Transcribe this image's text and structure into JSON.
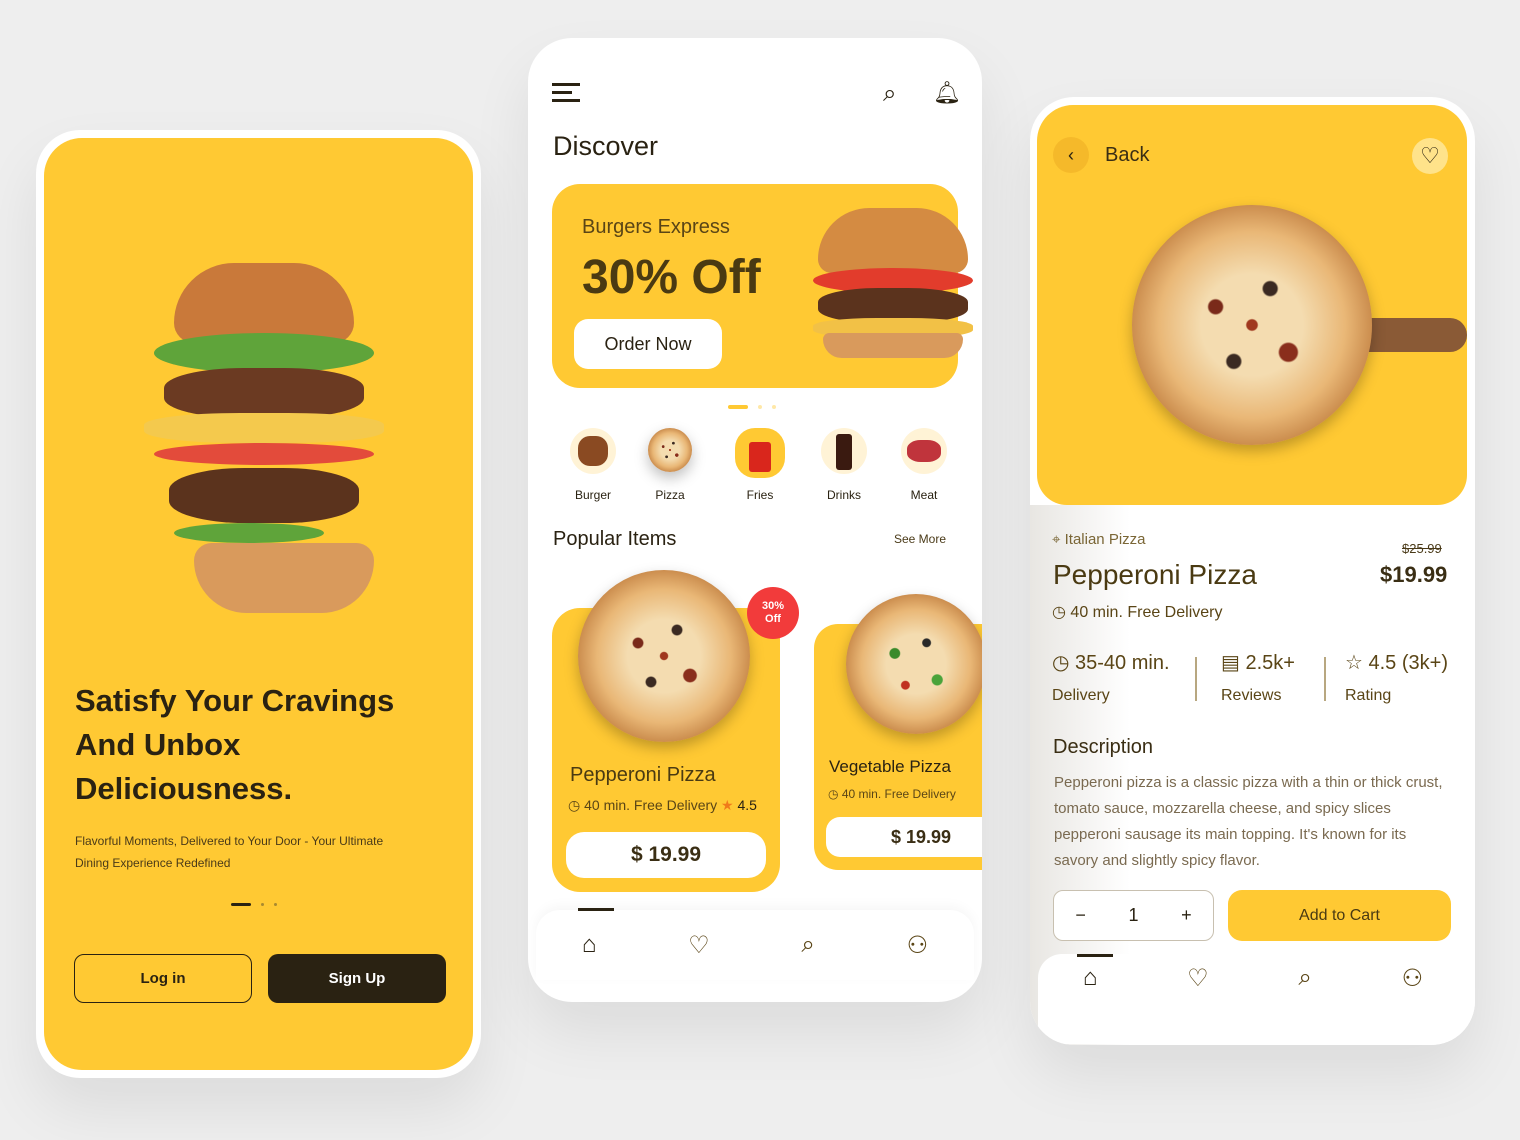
{
  "colors": {
    "accent": "#ffc933",
    "dark": "#2a2212",
    "brown": "#5a4516",
    "badge": "#f23b3b"
  },
  "onboarding": {
    "headline_lines": [
      "Satisfy Your Cravings",
      "And Unbox",
      "Deliciousness."
    ],
    "subtitle_lines": [
      "Flavorful Moments, Delivered to Your Door - Your Ultimate",
      "Dining Experience Redefined"
    ],
    "login_label": "Log in",
    "signup_label": "Sign Up"
  },
  "discover": {
    "title": "Discover",
    "icons": [
      "menu-icon",
      "search-icon",
      "bell-icon"
    ],
    "banner": {
      "subtitle": "Burgers Express",
      "headline": "30% Off",
      "button": "Order Now"
    },
    "categories": [
      {
        "label": "Burger"
      },
      {
        "label": "Pizza"
      },
      {
        "label": "Fries",
        "active": true
      },
      {
        "label": "Drinks"
      },
      {
        "label": "Meat"
      }
    ],
    "popular_title": "Popular Items",
    "see_more": "See More",
    "items": [
      {
        "name": "Pepperoni Pizza",
        "delivery": "40 min. Free Delivery",
        "rating": "4.5",
        "price": "$ 19.99",
        "badge": [
          "30%",
          "Off"
        ]
      },
      {
        "name": "Vegetable Pizza",
        "delivery": "40 min. Free Delivery",
        "price": "$ 19.99"
      }
    ],
    "nav": [
      "home-icon",
      "heart-icon",
      "search-icon",
      "user-icon"
    ]
  },
  "detail": {
    "back_label": "Back",
    "category": "Italian Pizza",
    "name": "Pepperoni Pizza",
    "old_price": "$25.99",
    "price": "$19.99",
    "delivery": "40 min. Free Delivery",
    "stats": [
      {
        "value": "35-40 min.",
        "label": "Delivery",
        "icon": "clock-icon"
      },
      {
        "value": "2.5k+",
        "label": "Reviews",
        "icon": "chat-icon"
      },
      {
        "value": "4.5 (3k+)",
        "label": "Rating",
        "icon": "star-icon"
      }
    ],
    "description_title": "Description",
    "description": "Pepperoni pizza is a classic pizza with a thin or thick crust, tomato sauce, mozzarella cheese, and spicy slices pepperoni sausage its main topping. It's known for its savory and slightly spicy flavor.",
    "quantity": "1",
    "minus": "−",
    "plus": "+",
    "add_to_cart": "Add to Cart"
  }
}
